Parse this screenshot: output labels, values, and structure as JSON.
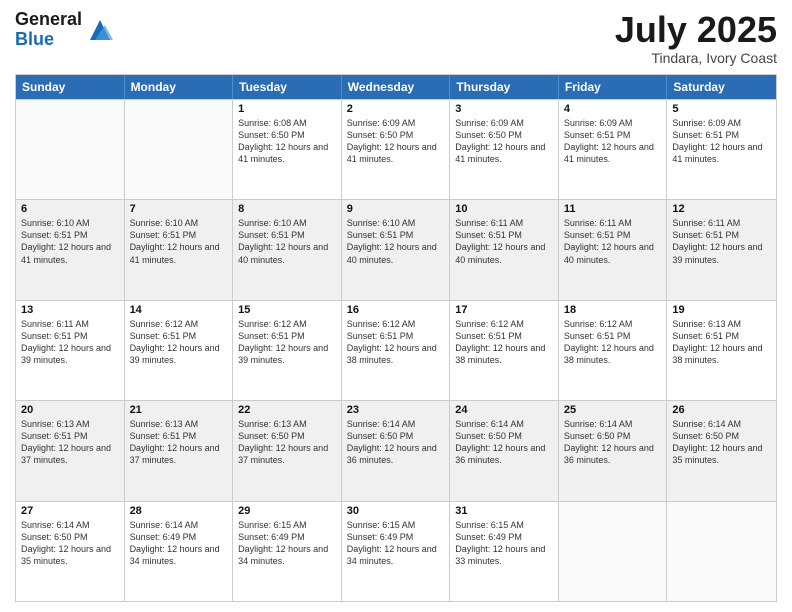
{
  "header": {
    "logo_line1": "General",
    "logo_line2": "Blue",
    "month": "July 2025",
    "location": "Tindara, Ivory Coast"
  },
  "days_of_week": [
    "Sunday",
    "Monday",
    "Tuesday",
    "Wednesday",
    "Thursday",
    "Friday",
    "Saturday"
  ],
  "rows": [
    [
      {
        "day": "",
        "info": "",
        "empty": true
      },
      {
        "day": "",
        "info": "",
        "empty": true
      },
      {
        "day": "1",
        "info": "Sunrise: 6:08 AM\nSunset: 6:50 PM\nDaylight: 12 hours and 41 minutes."
      },
      {
        "day": "2",
        "info": "Sunrise: 6:09 AM\nSunset: 6:50 PM\nDaylight: 12 hours and 41 minutes."
      },
      {
        "day": "3",
        "info": "Sunrise: 6:09 AM\nSunset: 6:50 PM\nDaylight: 12 hours and 41 minutes."
      },
      {
        "day": "4",
        "info": "Sunrise: 6:09 AM\nSunset: 6:51 PM\nDaylight: 12 hours and 41 minutes."
      },
      {
        "day": "5",
        "info": "Sunrise: 6:09 AM\nSunset: 6:51 PM\nDaylight: 12 hours and 41 minutes."
      }
    ],
    [
      {
        "day": "6",
        "info": "Sunrise: 6:10 AM\nSunset: 6:51 PM\nDaylight: 12 hours and 41 minutes."
      },
      {
        "day": "7",
        "info": "Sunrise: 6:10 AM\nSunset: 6:51 PM\nDaylight: 12 hours and 41 minutes."
      },
      {
        "day": "8",
        "info": "Sunrise: 6:10 AM\nSunset: 6:51 PM\nDaylight: 12 hours and 40 minutes."
      },
      {
        "day": "9",
        "info": "Sunrise: 6:10 AM\nSunset: 6:51 PM\nDaylight: 12 hours and 40 minutes."
      },
      {
        "day": "10",
        "info": "Sunrise: 6:11 AM\nSunset: 6:51 PM\nDaylight: 12 hours and 40 minutes."
      },
      {
        "day": "11",
        "info": "Sunrise: 6:11 AM\nSunset: 6:51 PM\nDaylight: 12 hours and 40 minutes."
      },
      {
        "day": "12",
        "info": "Sunrise: 6:11 AM\nSunset: 6:51 PM\nDaylight: 12 hours and 39 minutes."
      }
    ],
    [
      {
        "day": "13",
        "info": "Sunrise: 6:11 AM\nSunset: 6:51 PM\nDaylight: 12 hours and 39 minutes."
      },
      {
        "day": "14",
        "info": "Sunrise: 6:12 AM\nSunset: 6:51 PM\nDaylight: 12 hours and 39 minutes."
      },
      {
        "day": "15",
        "info": "Sunrise: 6:12 AM\nSunset: 6:51 PM\nDaylight: 12 hours and 39 minutes."
      },
      {
        "day": "16",
        "info": "Sunrise: 6:12 AM\nSunset: 6:51 PM\nDaylight: 12 hours and 38 minutes."
      },
      {
        "day": "17",
        "info": "Sunrise: 6:12 AM\nSunset: 6:51 PM\nDaylight: 12 hours and 38 minutes."
      },
      {
        "day": "18",
        "info": "Sunrise: 6:12 AM\nSunset: 6:51 PM\nDaylight: 12 hours and 38 minutes."
      },
      {
        "day": "19",
        "info": "Sunrise: 6:13 AM\nSunset: 6:51 PM\nDaylight: 12 hours and 38 minutes."
      }
    ],
    [
      {
        "day": "20",
        "info": "Sunrise: 6:13 AM\nSunset: 6:51 PM\nDaylight: 12 hours and 37 minutes."
      },
      {
        "day": "21",
        "info": "Sunrise: 6:13 AM\nSunset: 6:51 PM\nDaylight: 12 hours and 37 minutes."
      },
      {
        "day": "22",
        "info": "Sunrise: 6:13 AM\nSunset: 6:50 PM\nDaylight: 12 hours and 37 minutes."
      },
      {
        "day": "23",
        "info": "Sunrise: 6:14 AM\nSunset: 6:50 PM\nDaylight: 12 hours and 36 minutes."
      },
      {
        "day": "24",
        "info": "Sunrise: 6:14 AM\nSunset: 6:50 PM\nDaylight: 12 hours and 36 minutes."
      },
      {
        "day": "25",
        "info": "Sunrise: 6:14 AM\nSunset: 6:50 PM\nDaylight: 12 hours and 36 minutes."
      },
      {
        "day": "26",
        "info": "Sunrise: 6:14 AM\nSunset: 6:50 PM\nDaylight: 12 hours and 35 minutes."
      }
    ],
    [
      {
        "day": "27",
        "info": "Sunrise: 6:14 AM\nSunset: 6:50 PM\nDaylight: 12 hours and 35 minutes."
      },
      {
        "day": "28",
        "info": "Sunrise: 6:14 AM\nSunset: 6:49 PM\nDaylight: 12 hours and 34 minutes."
      },
      {
        "day": "29",
        "info": "Sunrise: 6:15 AM\nSunset: 6:49 PM\nDaylight: 12 hours and 34 minutes."
      },
      {
        "day": "30",
        "info": "Sunrise: 6:15 AM\nSunset: 6:49 PM\nDaylight: 12 hours and 34 minutes."
      },
      {
        "day": "31",
        "info": "Sunrise: 6:15 AM\nSunset: 6:49 PM\nDaylight: 12 hours and 33 minutes."
      },
      {
        "day": "",
        "info": "",
        "empty": true
      },
      {
        "day": "",
        "info": "",
        "empty": true
      }
    ]
  ]
}
